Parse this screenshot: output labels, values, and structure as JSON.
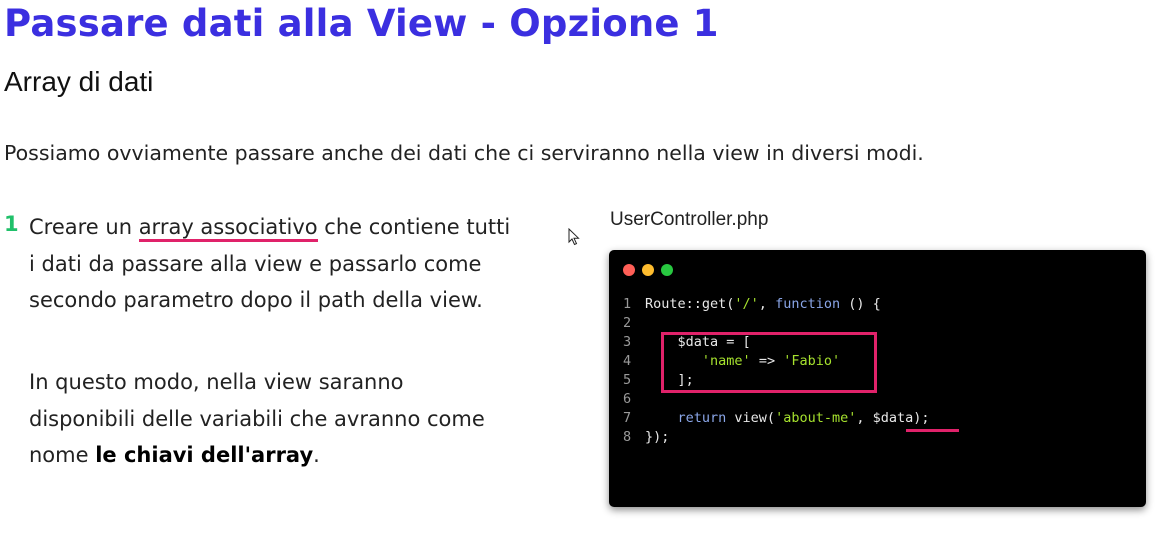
{
  "colors": {
    "title": "#3b2fe0",
    "step_number": "#20c06a",
    "highlight": "#e0226a",
    "code_bg": "#000000",
    "dot_red": "#ff5f57",
    "dot_yellow": "#febc2e",
    "dot_green": "#28c840"
  },
  "title": "Passare dati alla View - Opzione 1",
  "subtitle": "Array di dati",
  "intro": "Possiamo ovviamente passare anche dei dati che ci serviranno nella view in diversi modi.",
  "step": {
    "number": "1",
    "line1_pre": "Creare un ",
    "line1_highlight": "array associativo",
    "line1_post": " che contiene tutti",
    "line2": "i dati da passare alla view e passarlo come",
    "line3": "secondo parametro dopo il path della view.",
    "note_line1": "In questo modo, nella view saranno",
    "note_line2": "disponibili delle variabili che avranno come",
    "note_line3_pre": "nome ",
    "note_line3_bold": "le chiavi dell'array",
    "note_line3_post": "."
  },
  "file_label": "UserController.php",
  "code": {
    "line_numbers": [
      "1",
      "2",
      "3",
      "4",
      "5",
      "6",
      "7",
      "8"
    ],
    "l1_a": "Route::get(",
    "l1_b": "'/'",
    "l1_c": ", ",
    "l1_d": "function",
    "l1_e": " () {",
    "l3": "    $data = [",
    "l4_a": "       ",
    "l4_b": "'name'",
    "l4_c": " => ",
    "l4_d": "'Fabio'",
    "l5": "    ];",
    "l7_a": "    ",
    "l7_b": "return",
    "l7_c": " view(",
    "l7_d": "'about-me'",
    "l7_e": ", $data);",
    "l8": "});"
  }
}
